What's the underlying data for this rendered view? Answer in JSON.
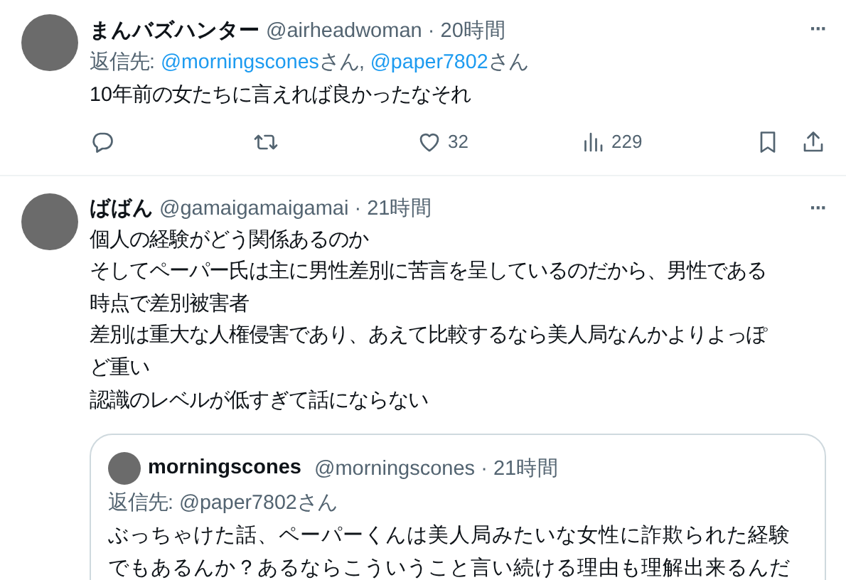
{
  "posts": [
    {
      "name": "まんバズハンター",
      "handle": "@airheadwoman",
      "separator": "·",
      "time": "20時間",
      "reply_to": {
        "label": "返信先:",
        "targets": [
          {
            "handle": "@morningscones",
            "suffix": "さん,"
          },
          {
            "handle": "@paper7802",
            "suffix": "さん"
          }
        ]
      },
      "lines": [
        "10年前の女たちに言えれば良かったなそれ"
      ],
      "actions": [
        {
          "kind": "reply"
        },
        {
          "kind": "repost"
        },
        {
          "kind": "like",
          "count": "32"
        },
        {
          "kind": "views",
          "count": "229"
        }
      ],
      "more": "···"
    },
    {
      "name": "ばばん",
      "handle": "@gamaigamaigamai",
      "separator": "·",
      "time": "21時間",
      "lines": [
        "個人の経験がどう関係あるのか",
        "そしてペーパー氏は主に男性差別に苦言を呈しているのだから、男性である",
        "時点で差別被害者",
        "差別は重大な人権侵害であり、あえて比較するなら美人局なんかよりよっぽ",
        "ど重い",
        "認識のレベルが低すぎて話にならない"
      ],
      "more": "···",
      "quote": {
        "name": "morningscones",
        "handle": "@morningscones",
        "separator": "·",
        "time": "21時間",
        "reply_to": {
          "label": "返信先:",
          "targets": [
            {
              "handle": "@paper7802",
              "suffix": "さん"
            }
          ]
        },
        "lines": [
          "ぶっちゃけた話、ペーパーくんは美人局みたいな女性に詐欺られた経験",
          "でもあるんか？あるならこういうこと言い続ける理由も理解出来るんだ"
        ]
      }
    }
  ]
}
